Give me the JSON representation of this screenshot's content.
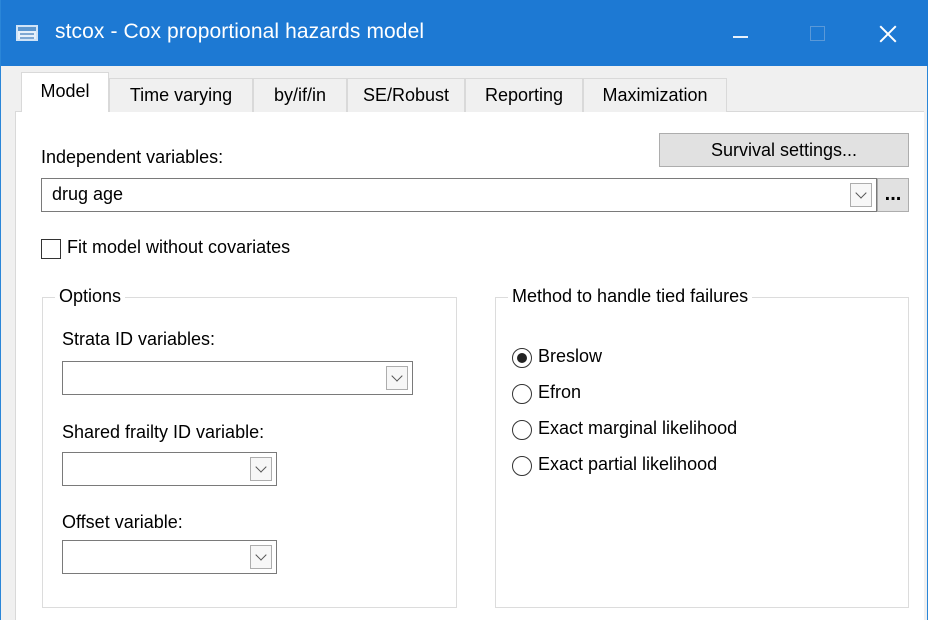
{
  "window": {
    "title": "stcox - Cox proportional hazards model"
  },
  "tabs": [
    {
      "label": "Model",
      "active": true
    },
    {
      "label": "Time varying"
    },
    {
      "label": "by/if/in"
    },
    {
      "label": "SE/Robust"
    },
    {
      "label": "Reporting"
    },
    {
      "label": "Maximization"
    }
  ],
  "model": {
    "survival_settings_label": "Survival settings...",
    "independent_variables_label": "Independent variables:",
    "independent_variables_value": "drug age",
    "ellipsis_label": "...",
    "fit_without_covariates_label": "Fit model without covariates",
    "fit_without_covariates_checked": false
  },
  "options": {
    "title": "Options",
    "strata_label": "Strata ID variables:",
    "strata_value": "",
    "shared_frailty_label": "Shared frailty ID variable:",
    "shared_frailty_value": "",
    "offset_label": "Offset variable:",
    "offset_value": ""
  },
  "ties": {
    "title": "Method to handle tied failures",
    "selected": "Breslow",
    "choices": [
      {
        "label": "Breslow"
      },
      {
        "label": "Efron"
      },
      {
        "label": "Exact marginal likelihood"
      },
      {
        "label": "Exact partial likelihood"
      }
    ]
  },
  "colors": {
    "titlebar": "#1d79d3",
    "window_bg": "#f0f0f0",
    "panel_bg": "#ffffff"
  },
  "icons": [
    "app-icon",
    "minimize-icon",
    "maximize-icon",
    "close-icon",
    "chevron-down-icon"
  ]
}
